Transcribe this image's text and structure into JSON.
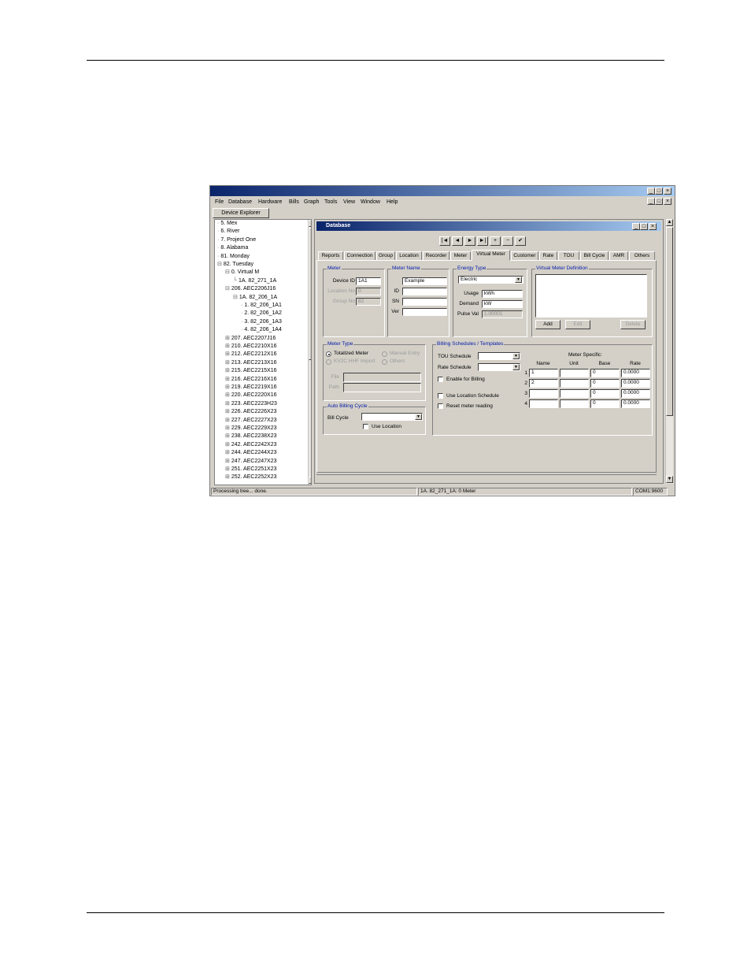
{
  "window": {
    "menu": [
      "File",
      "Database",
      "Hardware",
      "Bills",
      "Graph",
      "Tools",
      "View",
      "Window",
      "Help"
    ],
    "controls": {
      "minimize": "_",
      "maximize": "□",
      "close": "×"
    }
  },
  "device_explorer": {
    "label": "Device Explorer"
  },
  "tree": [
    {
      "text": "5. Mex",
      "prefix": "·"
    },
    {
      "text": "6. River",
      "prefix": "·"
    },
    {
      "text": "7. Project One",
      "prefix": "·"
    },
    {
      "text": "8. Alabama",
      "prefix": "·"
    },
    {
      "text": "81. Monday",
      "prefix": "·"
    },
    {
      "text": "82. Tuesday",
      "prefix": "⊟"
    },
    {
      "text": "0. Virtual M",
      "prefix": "⊟"
    },
    {
      "text": "1A. 82_271_1A",
      "prefix": "└"
    },
    {
      "text": "206. AEC2206J16",
      "prefix": "⊟"
    },
    {
      "text": "1A. 82_206_1A",
      "prefix": "⊟"
    },
    {
      "text": "1. 82_206_1A1",
      "prefix": "·"
    },
    {
      "text": "2. 82_206_1A2",
      "prefix": "·"
    },
    {
      "text": "3. 82_206_1A3",
      "prefix": "·"
    },
    {
      "text": "4. 82_206_1A4",
      "prefix": "·"
    },
    {
      "text": "207. AEC2207J16",
      "prefix": "⊞"
    },
    {
      "text": "210. AEC2210X16",
      "prefix": "⊞"
    },
    {
      "text": "212. AEC2212X16",
      "prefix": "⊞"
    },
    {
      "text": "213. AEC2213X16",
      "prefix": "⊞"
    },
    {
      "text": "215. AEC2215X16",
      "prefix": "⊞"
    },
    {
      "text": "216. AEC2216X16",
      "prefix": "⊞"
    },
    {
      "text": "219. AEC2219X16",
      "prefix": "⊞"
    },
    {
      "text": "220. AEC2220X16",
      "prefix": "⊞"
    },
    {
      "text": "223. AEC2223H23",
      "prefix": "⊞"
    },
    {
      "text": "226. AEC2226X23",
      "prefix": "⊞"
    },
    {
      "text": "227. AEC2227X23",
      "prefix": "⊞"
    },
    {
      "text": "229. AEC2229X23",
      "prefix": "⊞"
    },
    {
      "text": "238. AEC2238X23",
      "prefix": "⊞"
    },
    {
      "text": "242. AEC2242X23",
      "prefix": "⊞"
    },
    {
      "text": "244. AEC2244X23",
      "prefix": "⊞"
    },
    {
      "text": "247. AEC2247X23",
      "prefix": "⊞"
    },
    {
      "text": "251. AEC2251X23",
      "prefix": "⊞"
    },
    {
      "text": "252. AEC2252X23",
      "prefix": "⊞"
    }
  ],
  "db": {
    "title": "Database",
    "nav": [
      "|◄",
      "◄",
      "►",
      "►|",
      "+",
      "−",
      "✔"
    ],
    "tabs": [
      "Reports",
      "Connection",
      "Group",
      "Location",
      "Recorder",
      "Meter",
      "Virtual Meter",
      "Customer",
      "Rate",
      "TOU",
      "Bill Cycle",
      "AMR",
      "Others"
    ],
    "active_tab": "Virtual Meter",
    "meter": {
      "group": "Meter",
      "device_id_label": "Device ID",
      "device_id": "1A1",
      "location_label": "Location No",
      "location": "0",
      "group_no_label": "Group No",
      "group_no": "82"
    },
    "meter_name": {
      "group": "Meter Name",
      "name": "Example",
      "id_label": "ID",
      "sn_label": "SN",
      "ver_label": "Ver"
    },
    "energy": {
      "group": "Energy Type",
      "type": "Electric",
      "usage_label": "Usage",
      "usage": "kWh",
      "demand_label": "Demand",
      "demand": "kW",
      "pulse_label": "Pulse Val",
      "pulse": "1.00001"
    },
    "vmd": {
      "group": "Virtual Meter Definition",
      "add": "Add",
      "edit": "Edit",
      "delete": "Delete"
    },
    "meter_type": {
      "group": "Meter Type",
      "totalized": "Totalized  Meter",
      "manual": "Manual Entry",
      "kv2c": "KV2C HHF Import",
      "others": "Others",
      "file_label": "File",
      "path_label": "Path"
    },
    "billing": {
      "group": "Billing Schedules / Templates",
      "tou_label": "TOU Schedule",
      "rate_label": "Rate Schedule",
      "enable_billing": "Enable for Billing",
      "use_location": "Use Location Schedule",
      "reset_reading": "Reset meter reading",
      "specific_label": "Meter Specific:",
      "cols": [
        "Name",
        "Unit",
        "Base",
        "Rate"
      ],
      "rows": [
        {
          "num": "1",
          "name": "1",
          "unit": "",
          "base": "0",
          "rate": "0.0000"
        },
        {
          "num": "2",
          "name": "2",
          "unit": "",
          "base": "0",
          "rate": "0.0000"
        },
        {
          "num": "3",
          "name": "",
          "unit": "",
          "base": "0",
          "rate": "0.0000"
        },
        {
          "num": "4",
          "name": "",
          "unit": "",
          "base": "0",
          "rate": "0.0000"
        }
      ]
    },
    "auto_billing": {
      "group": "Auto Billing Cycle",
      "bill_cycle_label": "Bill Cycle",
      "use_location": "Use Location"
    }
  },
  "status": {
    "left": "Processing tree... done.",
    "mid": "1A. 82_271_1A: 0 Meter",
    "right": "COM1:9600"
  }
}
